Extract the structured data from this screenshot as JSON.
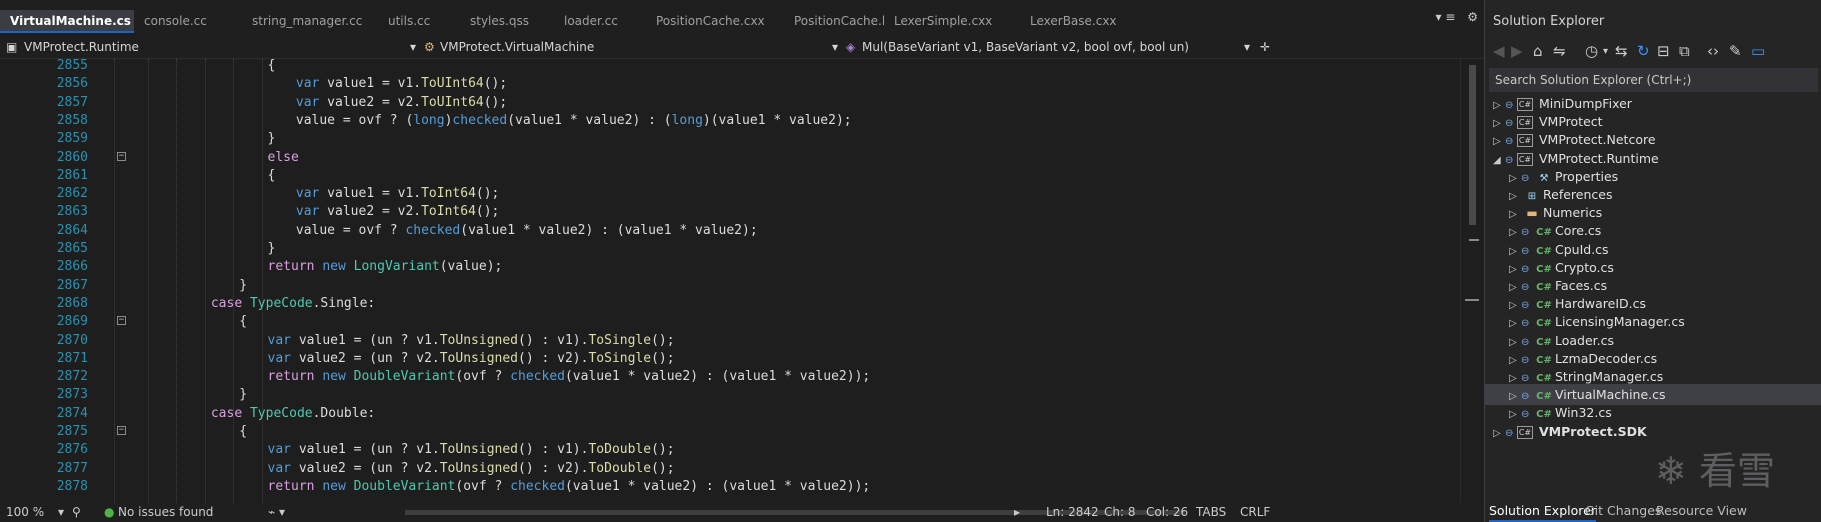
{
  "editor": {
    "tabs": [
      {
        "label": "VirtualMachine.cs",
        "active": true,
        "pin": "⊣",
        "close": "×"
      },
      {
        "label": "console.cc"
      },
      {
        "label": "string_manager.cc"
      },
      {
        "label": "utils.cc"
      },
      {
        "label": "styles.qss"
      },
      {
        "label": "loader.cc"
      },
      {
        "label": "PositionCache.cxx"
      },
      {
        "label": "PositionCache.h"
      },
      {
        "label": "LexerSimple.cxx"
      },
      {
        "label": "LexerBase.cxx"
      }
    ],
    "nav": {
      "project": "VMProtect.Runtime",
      "class": "VMProtect.VirtualMachine",
      "member": "Mul(BaseVariant v1, BaseVariant v2, bool ovf, bool un)"
    },
    "lines": [
      {
        "n": "2855",
        "fold": false,
        "indent": 18,
        "segs": [
          [
            "{",
            ""
          ]
        ]
      },
      {
        "n": "2856",
        "fold": false,
        "indent": 22,
        "segs": [
          [
            "var",
            "kw"
          ],
          [
            " value1 = v1.",
            ""
          ],
          [
            "ToUInt64",
            "mth"
          ],
          [
            "();",
            ""
          ]
        ]
      },
      {
        "n": "2857",
        "fold": false,
        "indent": 22,
        "segs": [
          [
            "var",
            "kw"
          ],
          [
            " value2 = v2.",
            ""
          ],
          [
            "ToUInt64",
            "mth"
          ],
          [
            "();",
            ""
          ]
        ]
      },
      {
        "n": "2858",
        "fold": false,
        "indent": 22,
        "segs": [
          [
            "value = ovf ? (",
            ""
          ],
          [
            "long",
            "kw"
          ],
          [
            ")",
            ""
          ],
          [
            "checked",
            "kw"
          ],
          [
            "(value1 * value2) : (",
            ""
          ],
          [
            "long",
            "kw"
          ],
          [
            ")(value1 * value2);",
            ""
          ]
        ]
      },
      {
        "n": "2859",
        "fold": false,
        "indent": 18,
        "segs": [
          [
            "}",
            ""
          ]
        ]
      },
      {
        "n": "2860",
        "fold": true,
        "indent": 18,
        "segs": [
          [
            "else",
            "ctl"
          ]
        ]
      },
      {
        "n": "2861",
        "fold": false,
        "indent": 18,
        "segs": [
          [
            "{",
            ""
          ]
        ]
      },
      {
        "n": "2862",
        "fold": false,
        "indent": 22,
        "segs": [
          [
            "var",
            "kw"
          ],
          [
            " value1 = v1.",
            ""
          ],
          [
            "ToInt64",
            "mth"
          ],
          [
            "();",
            ""
          ]
        ]
      },
      {
        "n": "2863",
        "fold": false,
        "indent": 22,
        "segs": [
          [
            "var",
            "kw"
          ],
          [
            " value2 = v2.",
            ""
          ],
          [
            "ToInt64",
            "mth"
          ],
          [
            "();",
            ""
          ]
        ]
      },
      {
        "n": "2864",
        "fold": false,
        "indent": 22,
        "segs": [
          [
            "value = ovf ? ",
            ""
          ],
          [
            "checked",
            "kw"
          ],
          [
            "(value1 * value2) : (value1 * value2);",
            ""
          ]
        ]
      },
      {
        "n": "2865",
        "fold": false,
        "indent": 18,
        "segs": [
          [
            "}",
            ""
          ]
        ]
      },
      {
        "n": "2866",
        "fold": false,
        "indent": 18,
        "segs": [
          [
            "return",
            "ctl"
          ],
          [
            " ",
            ""
          ],
          [
            "new",
            "kw"
          ],
          [
            " ",
            ""
          ],
          [
            "LongVariant",
            "typ"
          ],
          [
            "(value);",
            ""
          ]
        ]
      },
      {
        "n": "2867",
        "fold": false,
        "indent": 14,
        "segs": [
          [
            "}",
            ""
          ]
        ]
      },
      {
        "n": "2868",
        "fold": false,
        "indent": 10,
        "segs": [
          [
            "case",
            "ctl"
          ],
          [
            " ",
            ""
          ],
          [
            "TypeCode",
            "typ"
          ],
          [
            ".Single:",
            ""
          ]
        ]
      },
      {
        "n": "2869",
        "fold": true,
        "indent": 14,
        "segs": [
          [
            "{",
            ""
          ]
        ]
      },
      {
        "n": "2870",
        "fold": false,
        "indent": 18,
        "segs": [
          [
            "var",
            "kw"
          ],
          [
            " value1 = (un ? v1.",
            ""
          ],
          [
            "ToUnsigned",
            "mth"
          ],
          [
            "() : v1).",
            ""
          ],
          [
            "ToSingle",
            "mth"
          ],
          [
            "();",
            ""
          ]
        ]
      },
      {
        "n": "2871",
        "fold": false,
        "indent": 18,
        "segs": [
          [
            "var",
            "kw"
          ],
          [
            " value2 = (un ? v2.",
            ""
          ],
          [
            "ToUnsigned",
            "mth"
          ],
          [
            "() : v2).",
            ""
          ],
          [
            "ToSingle",
            "mth"
          ],
          [
            "();",
            ""
          ]
        ]
      },
      {
        "n": "2872",
        "fold": false,
        "indent": 18,
        "segs": [
          [
            "return",
            "ctl"
          ],
          [
            " ",
            ""
          ],
          [
            "new",
            "kw"
          ],
          [
            " ",
            ""
          ],
          [
            "DoubleVariant",
            "typ"
          ],
          [
            "(ovf ? ",
            ""
          ],
          [
            "checked",
            "kw"
          ],
          [
            "(value1 * value2) : (value1 * value2));",
            ""
          ]
        ]
      },
      {
        "n": "2873",
        "fold": false,
        "indent": 14,
        "segs": [
          [
            "}",
            ""
          ]
        ]
      },
      {
        "n": "2874",
        "fold": false,
        "indent": 10,
        "segs": [
          [
            "case",
            "ctl"
          ],
          [
            " ",
            ""
          ],
          [
            "TypeCode",
            "typ"
          ],
          [
            ".Double:",
            ""
          ]
        ]
      },
      {
        "n": "2875",
        "fold": true,
        "indent": 14,
        "segs": [
          [
            "{",
            ""
          ]
        ]
      },
      {
        "n": "2876",
        "fold": false,
        "indent": 18,
        "segs": [
          [
            "var",
            "kw"
          ],
          [
            " value1 = (un ? v1.",
            ""
          ],
          [
            "ToUnsigned",
            "mth"
          ],
          [
            "() : v1).",
            ""
          ],
          [
            "ToDouble",
            "mth"
          ],
          [
            "();",
            ""
          ]
        ]
      },
      {
        "n": "2877",
        "fold": false,
        "indent": 18,
        "segs": [
          [
            "var",
            "kw"
          ],
          [
            " value2 = (un ? v2.",
            ""
          ],
          [
            "ToUnsigned",
            "mth"
          ],
          [
            "() : v2).",
            ""
          ],
          [
            "ToDouble",
            "mth"
          ],
          [
            "();",
            ""
          ]
        ]
      },
      {
        "n": "2878",
        "fold": false,
        "indent": 18,
        "segs": [
          [
            "return",
            "ctl"
          ],
          [
            " ",
            ""
          ],
          [
            "new",
            "kw"
          ],
          [
            " ",
            ""
          ],
          [
            "DoubleVariant",
            "typ"
          ],
          [
            "(ovf ? ",
            ""
          ],
          [
            "checked",
            "kw"
          ],
          [
            "(value1 * value2) : (value1 * value2));",
            ""
          ]
        ]
      }
    ]
  },
  "status": {
    "zoom": "100 %",
    "issues": "No issues found",
    "ln": "Ln: 2842",
    "ch": "Ch: 8",
    "col": "Col: 26",
    "tabs": "TABS",
    "eol": "CRLF"
  },
  "solution_explorer": {
    "title": "Solution Explorer",
    "search_placeholder": "Search Solution Explorer (Ctrl+;)",
    "items": [
      {
        "label": "MiniDumpFixer",
        "level": 0,
        "icon": "proj",
        "bold": false
      },
      {
        "label": "VMProtect",
        "level": 0,
        "icon": "proj",
        "bold": false
      },
      {
        "label": "VMProtect.Netcore",
        "level": 0,
        "icon": "proj",
        "bold": false
      },
      {
        "label": "VMProtect.Runtime",
        "level": 0,
        "icon": "proj",
        "bold": false,
        "expanded": true
      },
      {
        "label": "Properties",
        "level": 1,
        "icon": "wrench",
        "bold": false
      },
      {
        "label": "References",
        "level": 1,
        "icon": "refs",
        "bold": false
      },
      {
        "label": "Numerics",
        "level": 1,
        "icon": "folder",
        "bold": false
      },
      {
        "label": "Core.cs",
        "level": 1,
        "icon": "cs",
        "bold": false
      },
      {
        "label": "CpuId.cs",
        "level": 1,
        "icon": "cs",
        "bold": false
      },
      {
        "label": "Crypto.cs",
        "level": 1,
        "icon": "cs",
        "bold": false
      },
      {
        "label": "Faces.cs",
        "level": 1,
        "icon": "cs",
        "bold": false
      },
      {
        "label": "HardwareID.cs",
        "level": 1,
        "icon": "cs",
        "bold": false
      },
      {
        "label": "LicensingManager.cs",
        "level": 1,
        "icon": "cs",
        "bold": false
      },
      {
        "label": "Loader.cs",
        "level": 1,
        "icon": "cs",
        "bold": false
      },
      {
        "label": "LzmaDecoder.cs",
        "level": 1,
        "icon": "cs",
        "bold": false
      },
      {
        "label": "StringManager.cs",
        "level": 1,
        "icon": "cs",
        "bold": false
      },
      {
        "label": "VirtualMachine.cs",
        "level": 1,
        "icon": "cs",
        "bold": false,
        "selected": true
      },
      {
        "label": "Win32.cs",
        "level": 1,
        "icon": "cs",
        "bold": false
      },
      {
        "label": "VMProtect.SDK",
        "level": 0,
        "icon": "proj",
        "bold": true
      }
    ],
    "bottom_tabs": [
      {
        "label": "Solution Explorer",
        "active": true
      },
      {
        "label": "Git Changes"
      },
      {
        "label": "Resource View"
      }
    ]
  },
  "watermark": "看雪",
  "icons": {
    "cs_glyph": "C#"
  }
}
